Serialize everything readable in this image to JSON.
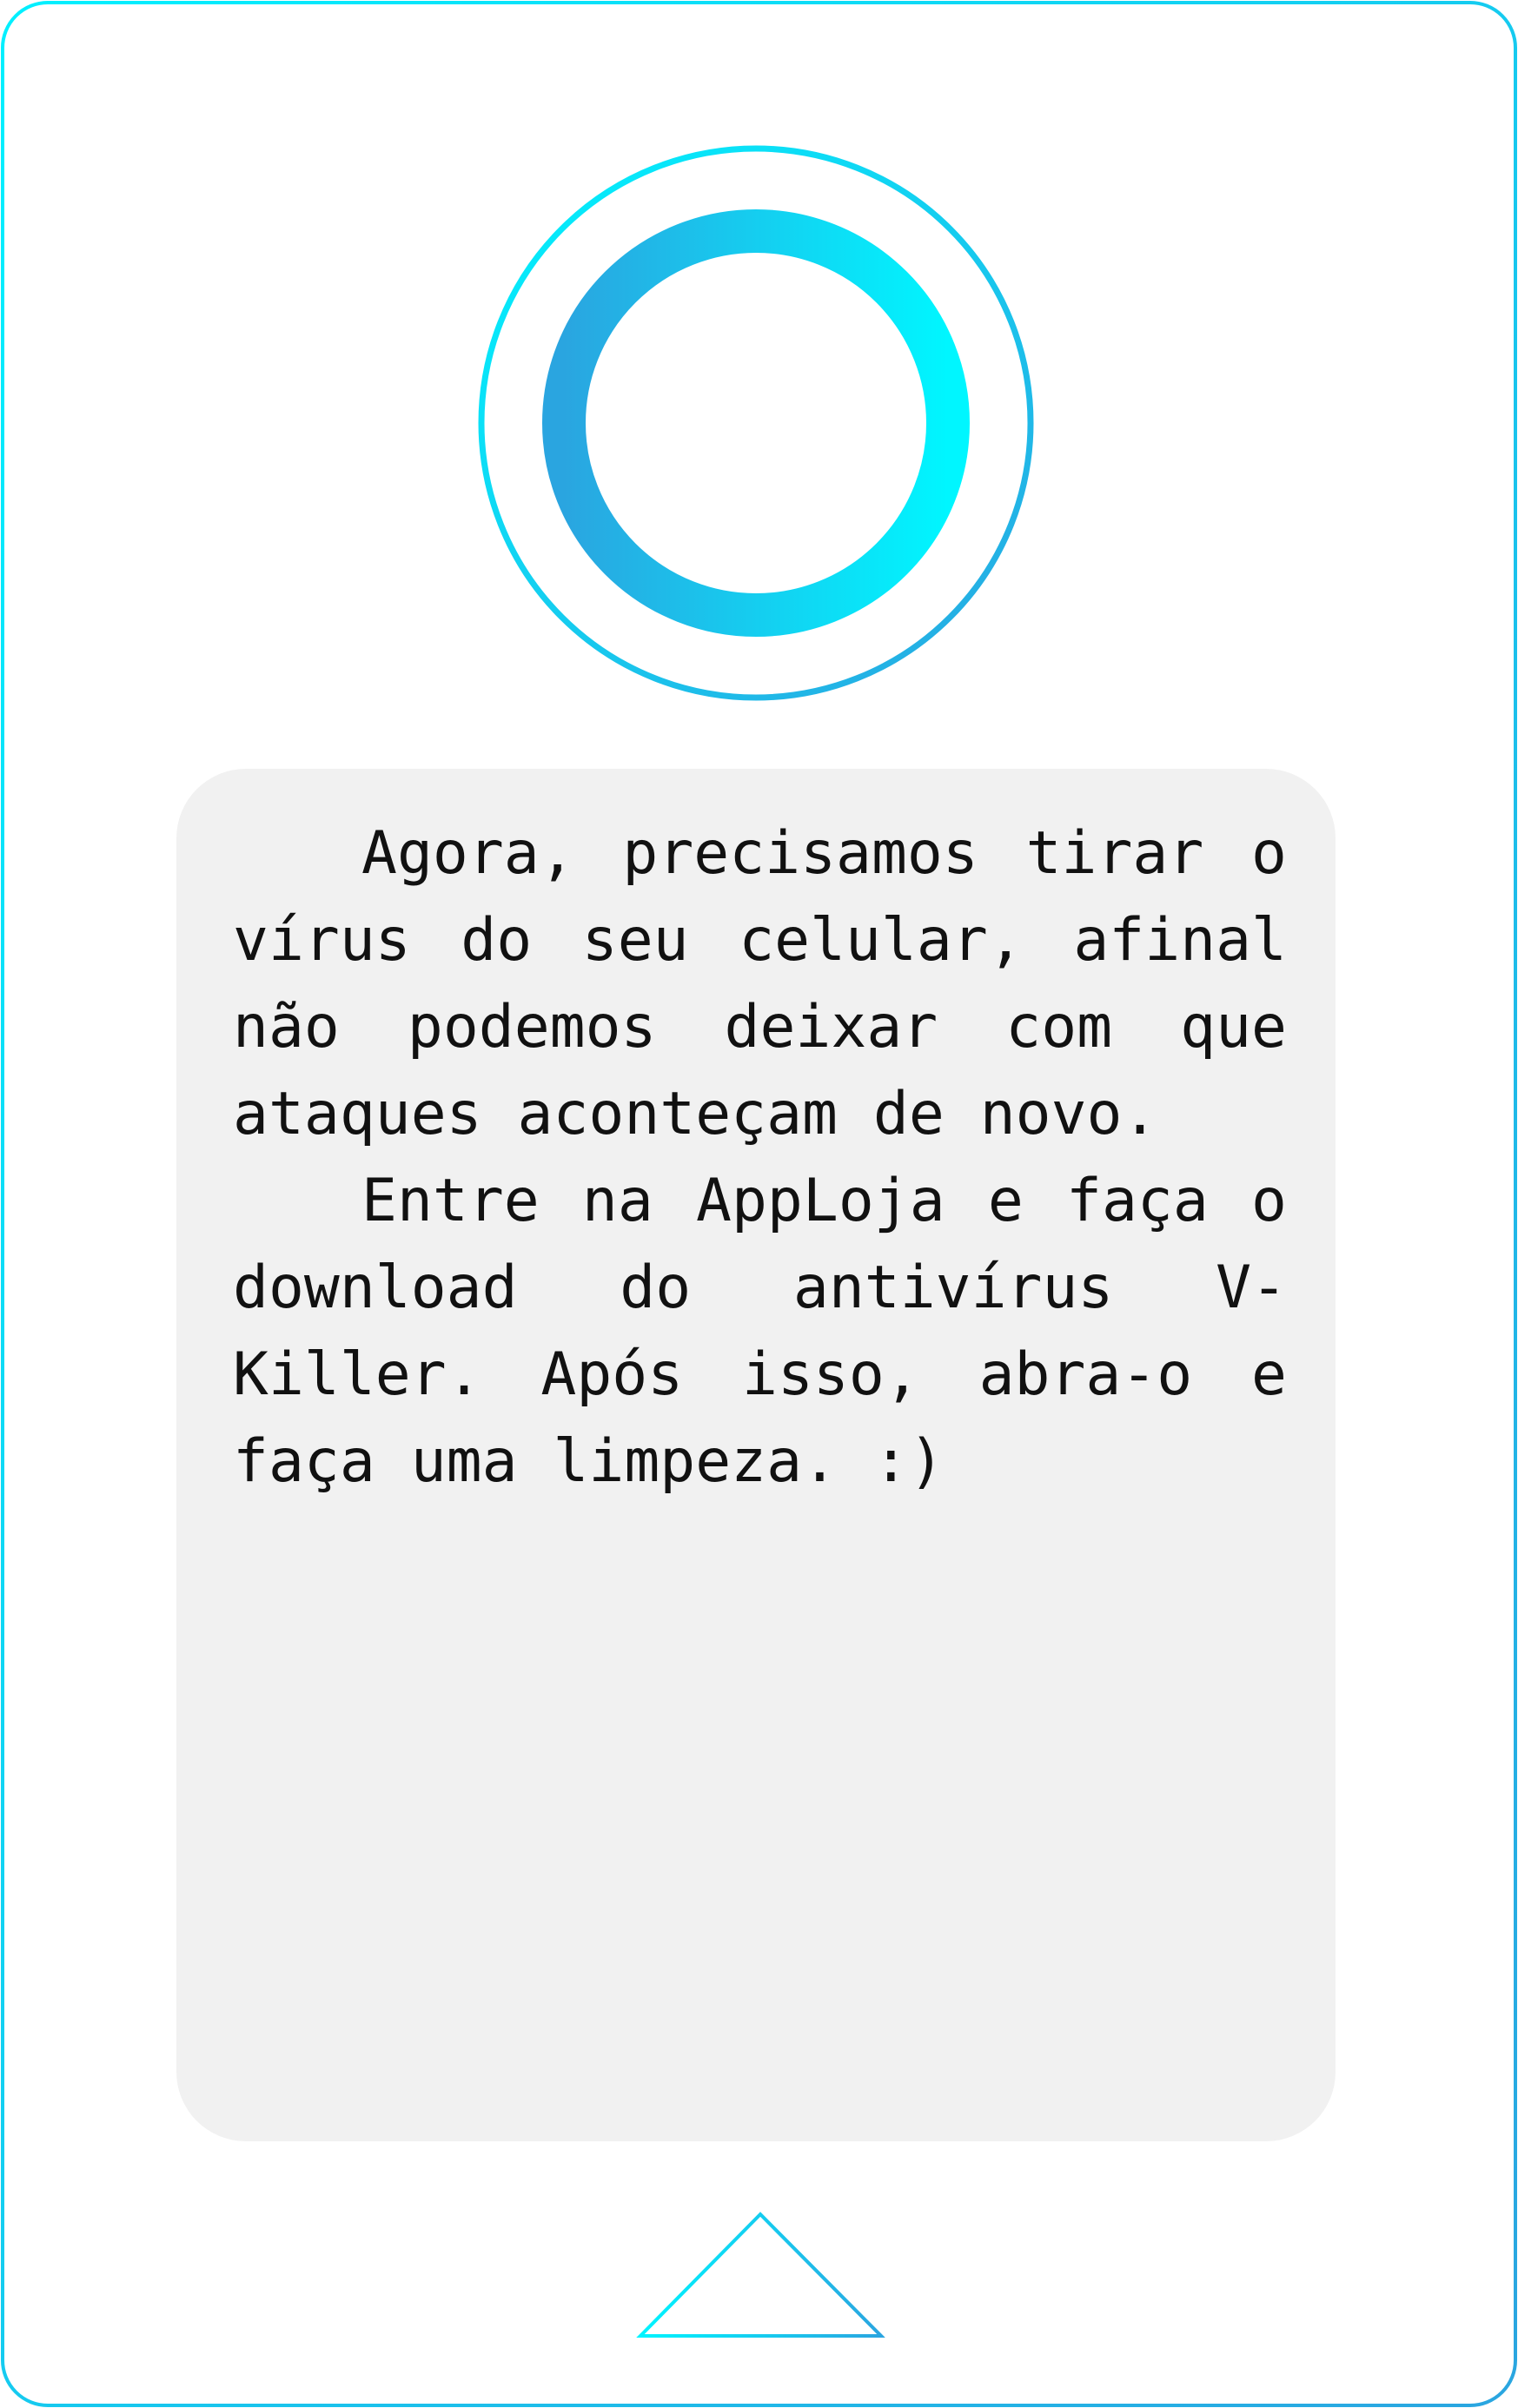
{
  "message": {
    "paragraphs": [
      "Agora, precisamos tirar o vírus do seu celular, afinal não podemos deixar com que ataques aconteçam de novo.",
      "Entre na AppLoja e faça o download do antivírus V-Killer. Após isso, abra-o e faça uma limpeza. :)"
    ]
  },
  "colors": {
    "cyan": "#00f4ff",
    "blue": "#2aa5e0",
    "card_background": "#f1f1f1",
    "text": "#111111"
  },
  "icons": {
    "top": "home-ring-icon",
    "bottom": "home-triangle-icon"
  }
}
